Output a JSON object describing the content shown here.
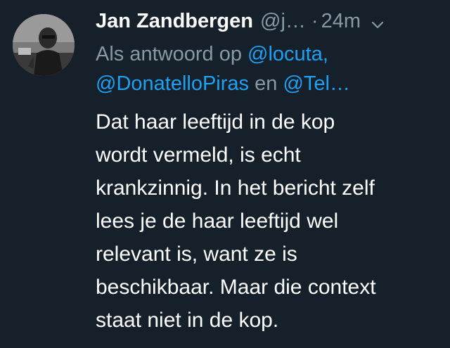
{
  "author": {
    "name": "Jan Zandbergen",
    "handle": "@j…",
    "separator": "·",
    "timestamp": "24m"
  },
  "reply": {
    "prefix": "Als antwoord op",
    "mention_1": "@locuta,",
    "mention_2": "@DonatelloPiras",
    "conjunction": "en",
    "mention_3": "@Tel…"
  },
  "body": {
    "lines": [
      "Dat haar leeftijd in de kop",
      "wordt vermeld, is echt",
      "krankzinnig. In het bericht zelf",
      "lees je de haar leeftijd wel",
      "relevant is, want ze is",
      "beschikbaar. Maar die context",
      "staat niet in de kop."
    ]
  },
  "icons": {
    "avatar": "profile-photo",
    "menu": "chevron-down-icon"
  },
  "colors": {
    "background": "#15202b",
    "text": "#ffffff",
    "muted": "#8899a6",
    "link": "#1da1f2"
  }
}
